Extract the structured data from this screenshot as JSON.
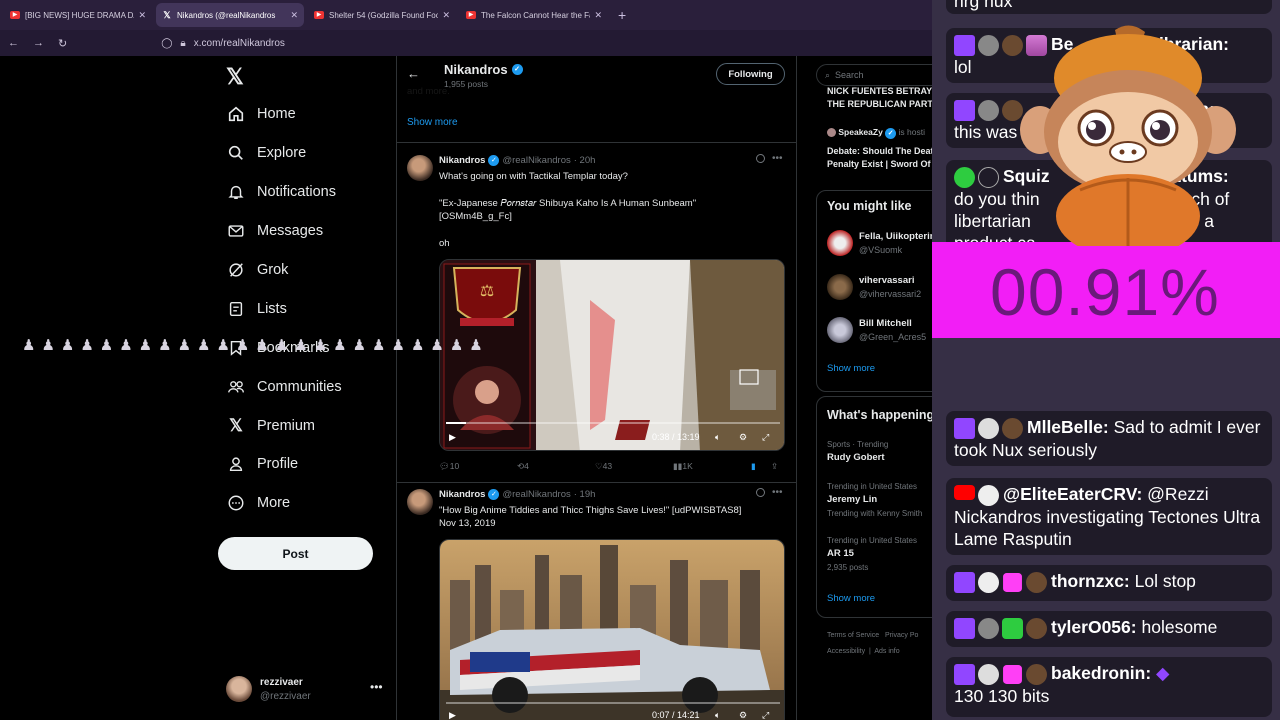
{
  "browser": {
    "tabs": [
      {
        "title": "[BIG NEWS] HUGE DRAMA DAY",
        "icon": "youtube-icon",
        "active": false
      },
      {
        "title": "Nikandros (@realNikandros",
        "icon": "x-icon",
        "active": true
      },
      {
        "title": "Shelter 54 (Godzilla Found Foot",
        "icon": "youtube-icon",
        "active": false
      },
      {
        "title": "The Falcon Cannot Hear the Falc",
        "icon": "youtube-icon",
        "active": false
      }
    ],
    "url": "x.com/realNikandros"
  },
  "sidebar": {
    "items": [
      {
        "label": "Home",
        "icon": "home-icon"
      },
      {
        "label": "Explore",
        "icon": "search-icon"
      },
      {
        "label": "Notifications",
        "icon": "bell-icon"
      },
      {
        "label": "Messages",
        "icon": "mail-icon"
      },
      {
        "label": "Grok",
        "icon": "grok-icon"
      },
      {
        "label": "Lists",
        "icon": "list-icon"
      },
      {
        "label": "Bookmarks",
        "icon": "bookmark-icon"
      },
      {
        "label": "Communities",
        "icon": "people-icon"
      },
      {
        "label": "Premium",
        "icon": "x-icon"
      },
      {
        "label": "Profile",
        "icon": "person-icon"
      },
      {
        "label": "More",
        "icon": "more-circle-icon"
      }
    ],
    "post_label": "Post",
    "account": {
      "name": "rezzivaer",
      "handle": "@rezzivaer"
    }
  },
  "profile": {
    "name": "Nikandros",
    "post_count": "1,955 posts",
    "following_label": "Following",
    "show_more": "Show more"
  },
  "tweets": [
    {
      "name": "Nikandros",
      "handle": "@realNikandros",
      "time": "· 20h",
      "lines": [
        "What's going on with Tactikal Templar today?",
        "\"Ex-Japanese 𝑃𝑜𝑟𝑛𝑠𝑡𝑎𝑟 Shibuya Kaho Is A Human Sunbeam\"",
        "[OSMm4B_g_Fc]",
        "oh"
      ],
      "video_time": "0:38 / 13:19",
      "stats": {
        "replies": "10",
        "reposts": "4",
        "likes": "43",
        "views": "1K"
      }
    },
    {
      "name": "Nikandros",
      "handle": "@realNikandros",
      "time": "· 19h",
      "lines": [
        "\"How Big Anime Tiddies and Thicc Thighs Save Lives!\" [udPWISBTAS8]",
        "Nov 13, 2019"
      ],
      "video_time": "0:07 / 14:21"
    }
  ],
  "right": {
    "search_placeholder": "Search",
    "top_snippet": [
      "NICK FUENTES BETRAYS",
      "THE REPUBLICAN PARTY"
    ],
    "space_host": "SpeakeaZy",
    "space_host_suffix": "is hosti",
    "space_title": [
      "Debate: Should The Death",
      "Penalty Exist | Sword Of Dea"
    ],
    "you_might_like": "You might like",
    "suggestions": [
      {
        "name": "Fella, Uiikopterin",
        "handle": "@VSuomk"
      },
      {
        "name": "vihervassari",
        "handle": "@vihervassari2"
      },
      {
        "name": "Bill Mitchell",
        "handle": "@Green_Acres5"
      }
    ],
    "show_more": "Show more",
    "whats_happening": "What's happening",
    "trends": [
      {
        "context": "Sports · Trending",
        "topic": "Rudy Gobert",
        "posts": ""
      },
      {
        "context": "Trending in United States",
        "topic": "Jeremy Lin",
        "posts": "Trending with Kenny Smith"
      },
      {
        "context": "Trending in United States",
        "topic": "AR 15",
        "posts": "2,935 posts"
      }
    ],
    "footer": [
      "Terms of Service",
      "Privacy Po",
      "Accessibility",
      "Ads info"
    ]
  },
  "chat": {
    "top_fragment": "nrg nux",
    "messages": [
      {
        "user": "Be",
        "user_tail": "Librarian:",
        "text": "lol"
      },
      {
        "user": "",
        "user_tail": "rian:",
        "text": "this was",
        "text_tail": "so"
      },
      {
        "user": "Squiz",
        "user_tail": "uttums:",
        "text": "do you thin",
        "text_tail": "nch of",
        "line3": "libertarian",
        "line3_tail": "ke a",
        "line4": "product ca"
      },
      {
        "user": "MlleBelle:",
        "text": "Sad to admit I ever took Nux seriously"
      },
      {
        "user": "@EliteEaterCRV:",
        "text": "@Rezzi Nickandros investigating Tectones Ultra Lame Rasputin"
      },
      {
        "user": "thornzxc:",
        "text": "Lol stop"
      },
      {
        "user": "tylerO056:",
        "text": "holesome"
      },
      {
        "user": "bakedronin:",
        "text": "130 130 bits"
      }
    ],
    "percent": "00.91%"
  }
}
